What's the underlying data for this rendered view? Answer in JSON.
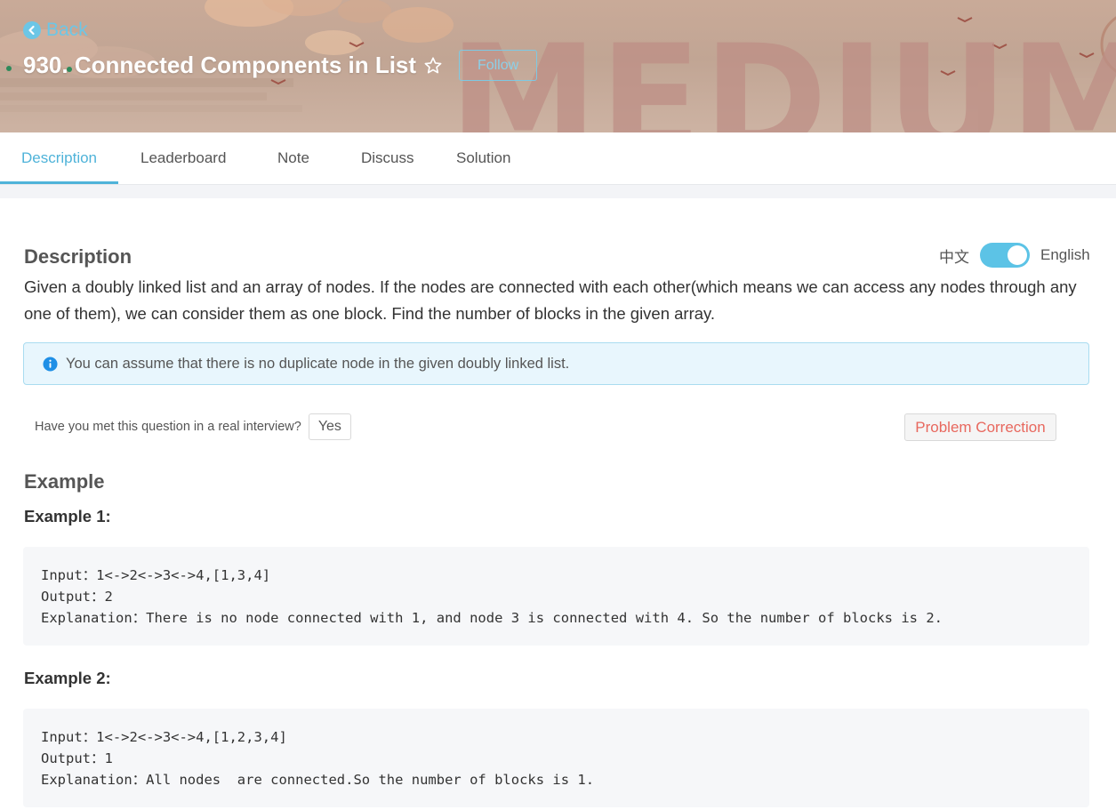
{
  "header": {
    "back_label": "Back",
    "title": "930. Connected Components in List",
    "star_icon": "star-outline-icon",
    "follow_label": "Follow",
    "watermark": "MEDIUM",
    "colors": {
      "banner": "#c4a797",
      "accent": "#6cc6e6",
      "watermark": "#be8f86"
    }
  },
  "tabs": [
    {
      "label": "Description",
      "active": true
    },
    {
      "label": "Leaderboard",
      "active": false
    },
    {
      "label": "Note",
      "active": false
    },
    {
      "label": "Discuss",
      "active": false
    },
    {
      "label": "Solution",
      "active": false
    }
  ],
  "description": {
    "heading": "Description",
    "lang_zh": "中文",
    "lang_en": "English",
    "language_toggle_on": true,
    "text": "Given a doubly linked list and an array of nodes. If the nodes are connected with each other(which means we can access any nodes through any one of them), we can consider them as one block. Find the number of blocks in the given array.",
    "note": "You can assume that there is no duplicate node in the given doubly linked list."
  },
  "interview": {
    "question": "Have you met this question in a real interview?",
    "yes_label": "Yes",
    "correction_label": "Problem Correction"
  },
  "examples": {
    "heading": "Example",
    "items": [
      {
        "title": "Example 1:",
        "input": "Input：1<->2<->3<->4,[1,3,4]",
        "output": "Output：2",
        "explanation": "Explanation：There is no node connected with 1, and node 3 is connected with 4. So the number of blocks is 2."
      },
      {
        "title": "Example 2:",
        "input": "Input：1<->2<->3<->4,[1,2,3,4]",
        "output": "Output：1",
        "explanation": "Explanation：All nodes  are connected.So the number of blocks is 1."
      }
    ]
  }
}
